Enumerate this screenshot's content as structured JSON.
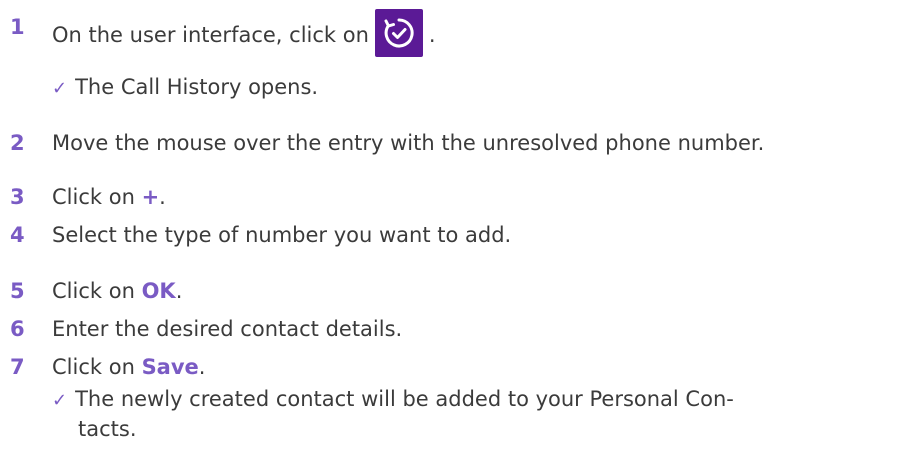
{
  "steps": [
    {
      "num": "1",
      "pre": "On the user interface, click on",
      "post": "."
    },
    {
      "num": "2",
      "text": "Move the mouse over the entry with the unresolved phone number."
    },
    {
      "num": "3",
      "pre": "Click on ",
      "hl": "+",
      "post": "."
    },
    {
      "num": "4",
      "text": "Select the type of number you want to add."
    },
    {
      "num": "5",
      "pre": "Click on ",
      "hl": "OK",
      "post": "."
    },
    {
      "num": "6",
      "text": "Enter the desired contact details."
    },
    {
      "num": "7",
      "pre": "Click on ",
      "hl": "Save",
      "post": "."
    }
  ],
  "results": {
    "call_history": "The Call History opens.",
    "contact_added_line1": "The newly created contact will be added to your Personal Con-",
    "contact_added_line2": "tacts."
  },
  "icons": {
    "history_icon": "call-history-icon",
    "check_icon": "checkmark-icon"
  },
  "colors": {
    "accent": "#7a5bc4",
    "icon_bg": "#5b1a96",
    "text": "#3b3b3b"
  }
}
